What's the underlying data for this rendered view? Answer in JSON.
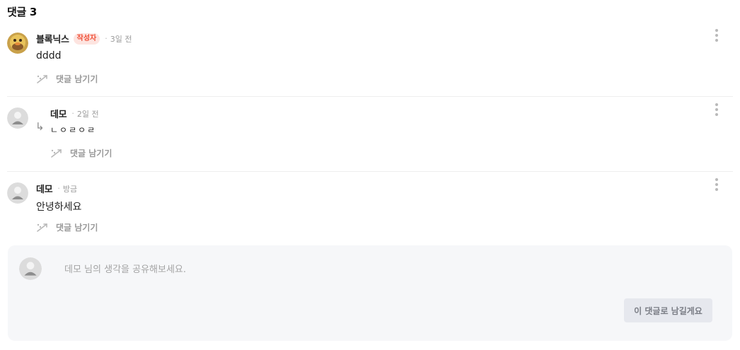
{
  "heading": "댓글 3",
  "comments": [
    {
      "author": "블록닉스",
      "badge": "작성자",
      "dot": "·",
      "time": "3일 전",
      "text": "dddd",
      "reply_label": "댓글 남기기",
      "avatar_icon": "duck-avatar-icon"
    },
    {
      "author": "데모",
      "dot": "·",
      "time": "2일 전",
      "text": "ㄴㅇㄹㅇㄹ",
      "reply_label": "댓글 남기기",
      "nested_arrow": "↳",
      "avatar_icon": "default-avatar-icon"
    },
    {
      "author": "데모",
      "dot": "·",
      "time": "방금",
      "text": "안녕하세요",
      "reply_label": "댓글 남기기",
      "avatar_icon": "default-avatar-icon"
    }
  ],
  "composer": {
    "placeholder": "데모 님의 생각을 공유해보세요.",
    "submit_label": "이 댓글로 남길게요",
    "avatar_icon": "default-avatar-icon"
  },
  "colors": {
    "badge_bg": "#fde4e0",
    "badge_text": "#f0523a",
    "composer_bg": "#f6f7f9",
    "button_bg": "#e6e8ee",
    "button_text": "#7b7e86"
  }
}
